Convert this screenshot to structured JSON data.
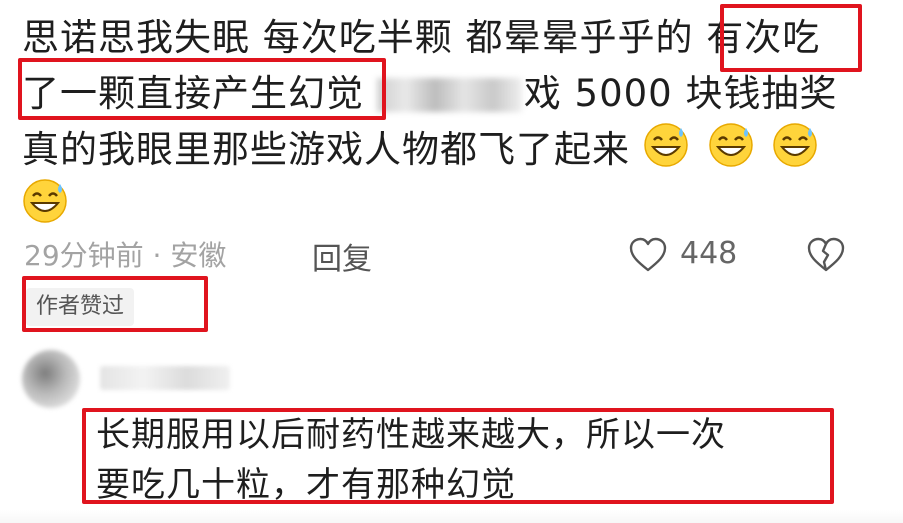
{
  "comment": {
    "lines": [
      "思诺思我失眠 每次吃半颗 都晕晕乎乎的 有次吃",
      "了一颗直接产生幻觉",
      "戏 5000 块钱抽奖",
      "真的我眼里那些游戏人物都飞了起来"
    ],
    "emoji_icon": "grinning-sweat-emoji",
    "meta": "29分钟前 · 安徽",
    "reply_label": "回复",
    "like_count": "448",
    "author_badge": "作者赞过"
  },
  "reply": {
    "lines": [
      "长期服用以后耐药性越来越大，所以一次",
      "要吃几十粒，才有那种幻觉"
    ]
  },
  "annotation_color": "#e0141e"
}
